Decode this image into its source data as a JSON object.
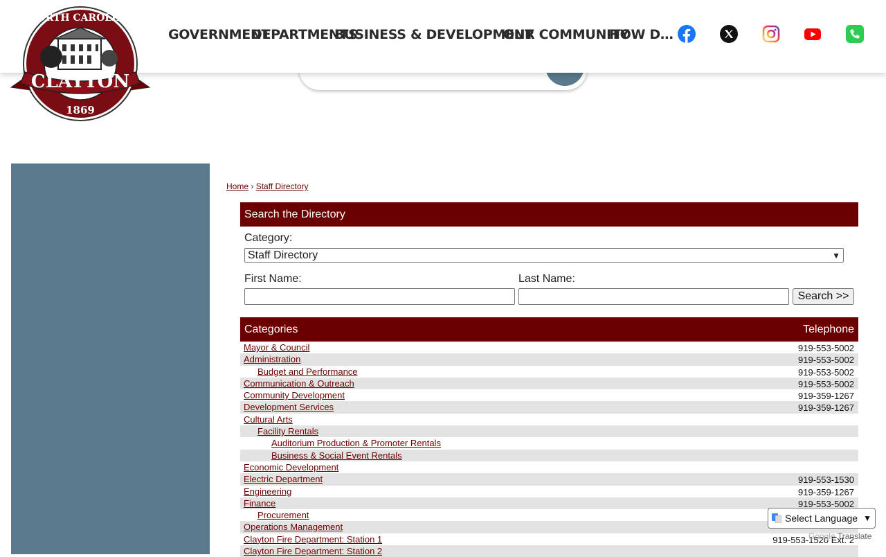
{
  "header": {
    "logo": {
      "top": "NORTH CAROLINA",
      "name": "CLAYTON",
      "year": "1869"
    },
    "nav": [
      "GOVERNMENT",
      "DEPARTMENTS",
      "BUSINESS & DEVELOPMENT",
      "OUR COMMUNITY",
      "HOW DO I..."
    ],
    "social": [
      "facebook-icon",
      "x-icon",
      "instagram-icon",
      "youtube-icon",
      "phone-icon"
    ]
  },
  "breadcrumb": {
    "home": "Home",
    "separator": "›",
    "current": "Staff Directory"
  },
  "search_panel": {
    "title": "Search the Directory",
    "category_label": "Category:",
    "category_selected": "Staff Directory",
    "first_name_label": "First Name:",
    "last_name_label": "Last Name:",
    "search_button": "Search >>"
  },
  "categories": {
    "header": "Categories",
    "telephone_header": "Telephone",
    "rows": [
      {
        "name": "Mayor & Council",
        "indent": 0,
        "tel": "919-553-5002"
      },
      {
        "name": "Administration",
        "indent": 0,
        "tel": "919-553-5002"
      },
      {
        "name": "Budget and Performance",
        "indent": 1,
        "tel": "919-553-5002"
      },
      {
        "name": "Communication & Outreach",
        "indent": 0,
        "tel": "919-553-5002"
      },
      {
        "name": "Community Development",
        "indent": 0,
        "tel": "919-359-1267"
      },
      {
        "name": "Development Services",
        "indent": 0,
        "tel": "919-359-1267"
      },
      {
        "name": "Cultural Arts",
        "indent": 0,
        "tel": ""
      },
      {
        "name": "Facility Rentals",
        "indent": 1,
        "tel": ""
      },
      {
        "name": "Auditorium Production & Promoter Rentals",
        "indent": 2,
        "tel": ""
      },
      {
        "name": "Business & Social Event Rentals",
        "indent": 2,
        "tel": ""
      },
      {
        "name": "Economic Development",
        "indent": 0,
        "tel": ""
      },
      {
        "name": "Electric Department",
        "indent": 0,
        "tel": "919-553-1530"
      },
      {
        "name": "Engineering",
        "indent": 0,
        "tel": "919-359-1267"
      },
      {
        "name": "Finance",
        "indent": 0,
        "tel": "919-553-5002"
      },
      {
        "name": "Procurement",
        "indent": 1,
        "tel": ""
      },
      {
        "name": "Operations Management",
        "indent": 0,
        "tel": ""
      },
      {
        "name": "Clayton Fire Department: Station 1",
        "indent": 0,
        "tel": "919-553-1520 Ext. 2"
      },
      {
        "name": "Clayton Fire Department: Station 2",
        "indent": 0,
        "tel": ""
      }
    ]
  },
  "translate": {
    "label": "Select Language",
    "powered": "Translate"
  },
  "colors": {
    "brand": "#6b0000",
    "sidebar": "#587a8c"
  }
}
